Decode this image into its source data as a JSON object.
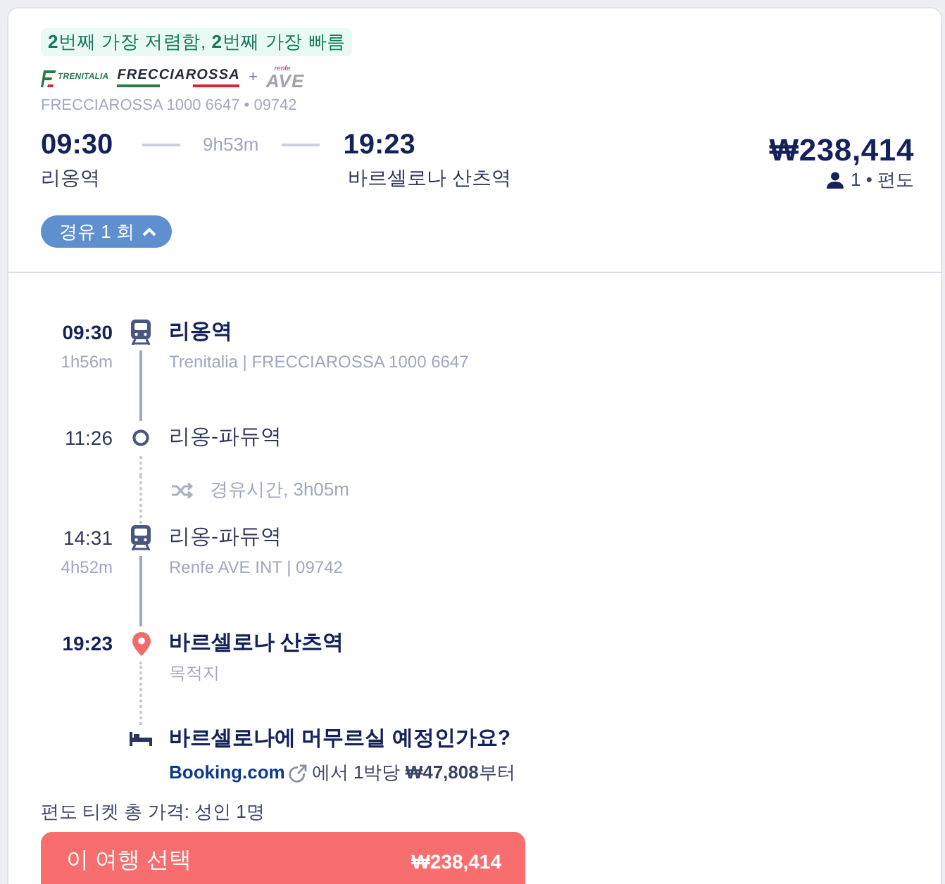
{
  "card": {
    "badge": "**2**번째 가장 저렴함, **2**번째 가장 빠름",
    "logos": [
      {
        "kind": "mark-text",
        "text": "TRENITALIA"
      },
      {
        "kind": "striped",
        "text": "FRECCIAROSSA"
      },
      {
        "kind": "plus",
        "text": "+"
      },
      {
        "kind": "stacked",
        "small": "renfe",
        "text": "AVE"
      }
    ],
    "service": "FRECCIAROSSA 1000 6647 • 09742",
    "departure": {
      "time": "09:30",
      "station": "리옹역"
    },
    "duration": "9h53m",
    "arrival": {
      "time": "19:23",
      "station": "바르셀로나 산츠역"
    },
    "price": "₩238,414",
    "passenger_info": "1 • 편도",
    "stops_toggle": {
      "label": "경유 1 회",
      "expanded": true
    }
  },
  "itinerary": [
    {
      "kind": "train",
      "highlighted": true,
      "time": "09:30",
      "duration": "1h56m",
      "station": "리옹역",
      "detail": "Trenitalia | FRECCIAROSSA 1000 6647",
      "connector": {
        "kind": "solid"
      }
    },
    {
      "kind": "stop",
      "highlighted": false,
      "time": "11:26",
      "station": "리옹-파듀역",
      "connector": {
        "kind": "dotted"
      }
    },
    {
      "kind": "transfer",
      "text": "경유시간, 3h05m",
      "connector": {
        "kind": "dotted"
      }
    },
    {
      "kind": "train",
      "highlighted": false,
      "time": "14:31",
      "duration": "4h52m",
      "station": "리옹-파듀역",
      "detail": "Renfe AVE INT | 09742",
      "connector": {
        "kind": "solid"
      }
    },
    {
      "kind": "destination",
      "highlighted": true,
      "time": "19:23",
      "station": "바르셀로나 산츠역",
      "detail": "목적지",
      "connector": {
        "kind": "dotted"
      }
    },
    {
      "kind": "hotel",
      "title": "바르셀로나에 머무르실 예정인가요?",
      "provider": "Booking.com",
      "offer": "에서 1박당 **₩47,808**부터"
    }
  ],
  "total_label": "편도 티켓 총 가격: 성인 1명",
  "select_button": {
    "label": "이 여행 선택",
    "price": "₩238,414"
  }
}
